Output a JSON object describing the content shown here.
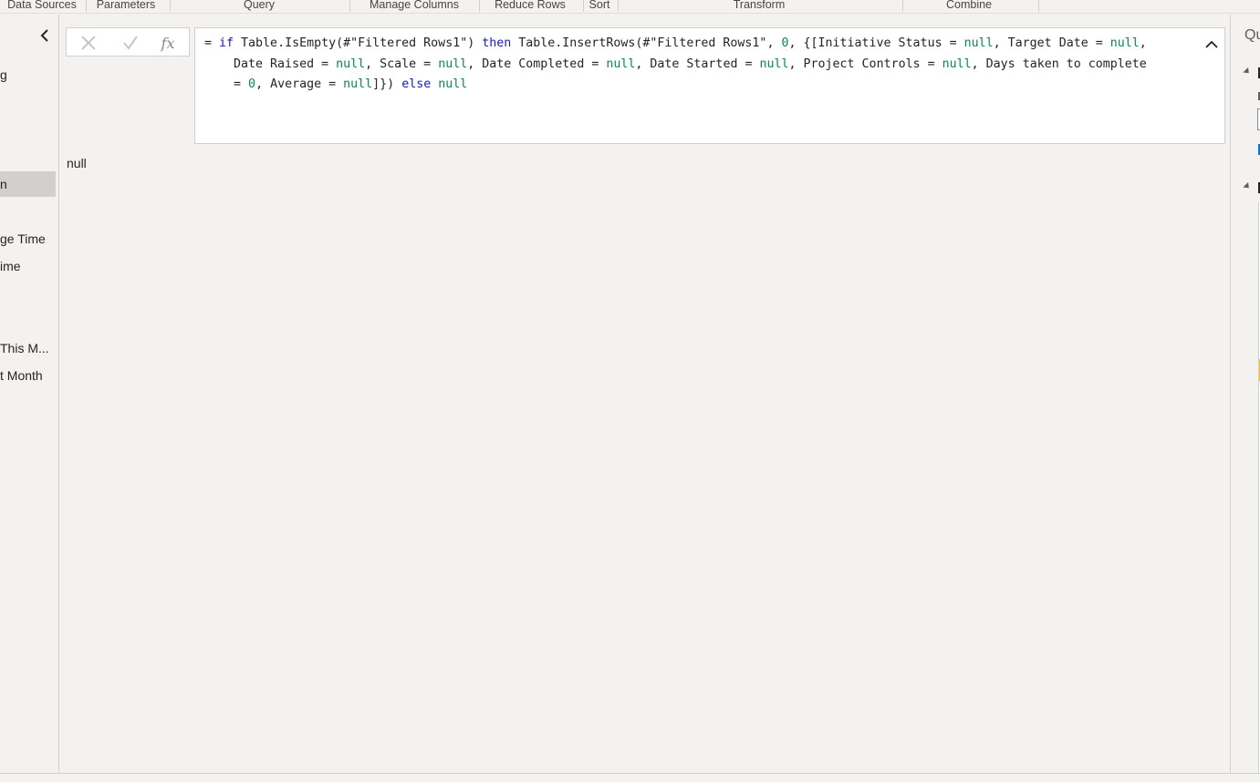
{
  "ribbon": {
    "groups": [
      {
        "label": "Data Sources"
      },
      {
        "label": "Parameters"
      },
      {
        "label": "Query"
      },
      {
        "label": "Manage Columns"
      },
      {
        "label": "Reduce Rows"
      },
      {
        "label": "Sort"
      },
      {
        "label": "Transform"
      },
      {
        "label": "Combine"
      }
    ]
  },
  "queries": {
    "items": [
      {
        "label": "g"
      },
      {
        "label": "n"
      },
      {
        "label": "ge Time"
      },
      {
        "label": "ime"
      },
      {
        "label": "This M..."
      },
      {
        "label": "t Month"
      }
    ]
  },
  "formula_bar": {
    "controls": {
      "cancel_icon": "x-icon",
      "commit_icon": "check-icon",
      "fx_label": "fx"
    },
    "line1": {
      "p1": "= ",
      "k1": "if",
      "p2": " Table.IsEmpty(#\"Filtered Rows1\") ",
      "k2": "then",
      "p3": " Table.InsertRows(#\"Filtered Rows1\", ",
      "n1": "0",
      "p4": ", {[Initiative Status = ",
      "n2": "null",
      "p5": ", Target Date = ",
      "n3": "null",
      "p6": ","
    },
    "line2": {
      "p1": "    Date Raised = ",
      "n1": "null",
      "p2": ", Scale = ",
      "n2": "null",
      "p3": ", Date Completed = ",
      "n3": "null",
      "p4": ", Date Started = ",
      "n4": "null",
      "p5": ", Project Controls = ",
      "n5": "null",
      "p6": ", Days taken to complete"
    },
    "line3": {
      "p1": "    = ",
      "n1": "0",
      "p2": ", Average = ",
      "n2": "null",
      "p3": "]}) ",
      "k1": "else",
      "p4": " ",
      "n3": "null"
    }
  },
  "preview": {
    "value": "null"
  },
  "settings_pane": {
    "title": "Qu"
  },
  "colors": {
    "keyword": "#1b1bbf",
    "literal": "#098658",
    "background": "#f3f2f1",
    "selected": "#d2d0ce"
  }
}
